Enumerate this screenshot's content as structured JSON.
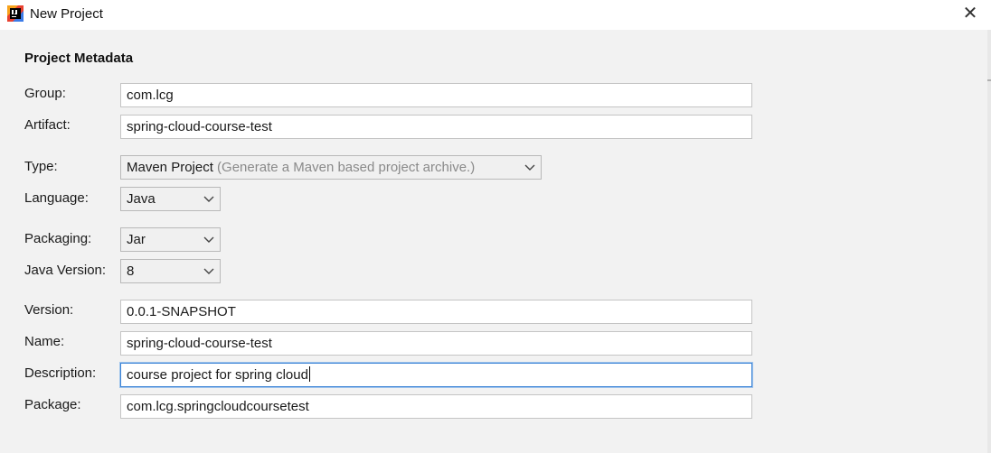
{
  "window": {
    "title": "New Project",
    "app_icon": "intellij-idea-icon",
    "close_glyph": "✕"
  },
  "section": {
    "title": "Project Metadata"
  },
  "fields": {
    "group": {
      "label": "Group:",
      "value": "com.lcg"
    },
    "artifact": {
      "label": "Artifact:",
      "value": "spring-cloud-course-test"
    },
    "type": {
      "label": "Type:",
      "value": "Maven Project",
      "hint": "(Generate a Maven based project archive.)"
    },
    "language": {
      "label": "Language:",
      "value": "Java"
    },
    "packaging": {
      "label": "Packaging:",
      "value": "Jar"
    },
    "java_version": {
      "label": "Java Version:",
      "value": "8"
    },
    "version": {
      "label": "Version:",
      "value": "0.0.1-SNAPSHOT"
    },
    "name": {
      "label": "Name:",
      "value": "spring-cloud-course-test"
    },
    "description": {
      "label": "Description:",
      "value": "course project for spring cloud"
    },
    "package": {
      "label": "Package:",
      "value": "com.lcg.springcloudcoursetest"
    }
  },
  "colors": {
    "background": "#f2f2f2",
    "focus_border": "#3b83d6"
  }
}
